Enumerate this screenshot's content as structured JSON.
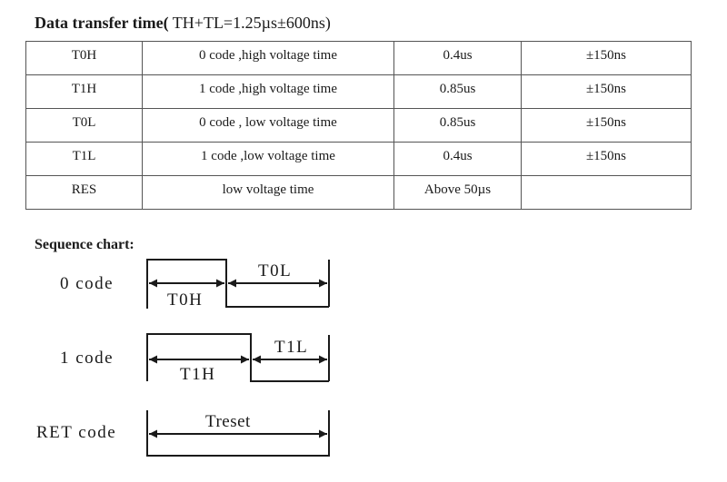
{
  "title": {
    "bold": "Data transfer time(",
    "normal": " TH+TL=1.25µs±600ns)"
  },
  "table": {
    "rows": [
      {
        "symbol": "T0H",
        "description": "0 code ,high voltage time",
        "value": "0.4us",
        "tolerance": "±150ns"
      },
      {
        "symbol": "T1H",
        "description": "1 code ,high voltage time",
        "value": "0.85us",
        "tolerance": "±150ns"
      },
      {
        "symbol": "T0L",
        "description": "0 code , low voltage time",
        "value": "0.85us",
        "tolerance": "±150ns"
      },
      {
        "symbol": "T1L",
        "description": "1 code ,low voltage time",
        "value": "0.4us",
        "tolerance": "±150ns"
      },
      {
        "symbol": "RES",
        "description": "low voltage time",
        "value": "Above 50µs",
        "tolerance": ""
      }
    ]
  },
  "sequence": {
    "title": "Sequence chart:",
    "codes": [
      {
        "label": "0 code",
        "high_label": "T0H",
        "low_label": "T0L"
      },
      {
        "label": "1 code",
        "high_label": "T1H",
        "low_label": "T1L"
      },
      {
        "label": "RET code",
        "span_label": "Treset"
      }
    ]
  }
}
